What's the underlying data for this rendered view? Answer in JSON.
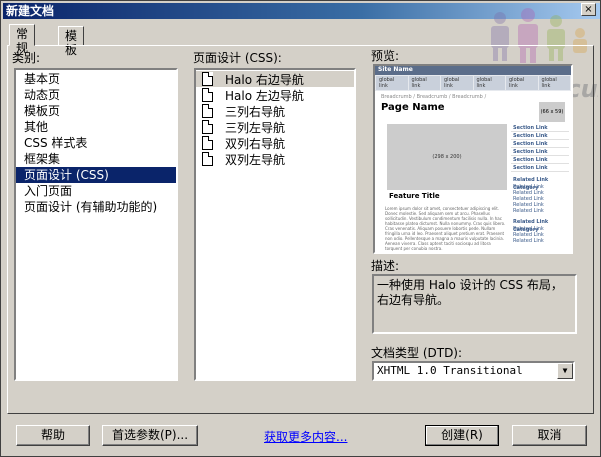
{
  "window": {
    "title": "新建文档",
    "close_glyph": "×"
  },
  "tabs": [
    {
      "label": "常规",
      "active": true
    },
    {
      "label": "模板",
      "active": false
    }
  ],
  "category": {
    "label": "类别:",
    "items": [
      "基本页",
      "动态页",
      "模板页",
      "其他",
      "CSS 样式表",
      "框架集",
      "页面设计 (CSS)",
      "入门页面",
      "页面设计 (有辅助功能的)"
    ],
    "selected_index": 6
  },
  "layouts": {
    "label": "页面设计 (CSS):",
    "items": [
      "Halo 右边导航",
      "Halo 左边导航",
      "三列右导航",
      "三列左导航",
      "双列右导航",
      "双列左导航"
    ],
    "selected_index": 0
  },
  "preview": {
    "label": "预览:",
    "page": {
      "site_name": "Site Name",
      "nav_items": [
        "global link",
        "global link",
        "global link",
        "global link",
        "global link",
        "global link"
      ],
      "breadcrumb": "Breadcrumb / Breadcrumb / Breadcrumb /",
      "page_name": "Page Name",
      "thumb": "(66 x 59)",
      "image": "(298 x 200)",
      "feature_title": "Feature Title",
      "body_text": "Lorem ipsum dolor sit amet, consectetuer adipiscing elit. Donec molestie. Sed aliquam sem ut arcu. Phasellus sollicitudin. Vestibulum condimentum facilisis nulla. In hac habitasse platea dictumst. Nulla nonummy. Cras quis libero. Cras venenatis. Aliquam posuere lobortis pede. Nullam fringilla urna id leo. Praesent aliquet pretium erat. Praesent non odio. Pellentesque a magna a mauris vulputate lacinia. Aenean viverra. Class aptent taciti sociosqu ad litora torquent per conubia nostra.",
      "section_links": [
        "Section Link",
        "Section Link",
        "Section Link",
        "Section Link",
        "Section Link",
        "Section Link"
      ],
      "related_category_1": "Related Link Category",
      "related_links_1": [
        "Related Link",
        "Related Link",
        "Related Link",
        "Related Link",
        "Related Link"
      ],
      "related_category_2": "Related Link Category",
      "related_links_2": [
        "Related Link",
        "Related Link",
        "Related Link"
      ]
    }
  },
  "watermark": {
    "text": "Discuz!"
  },
  "description": {
    "label": "描述:",
    "text": "一种使用 Halo 设计的 CSS 布局，右边有导航。"
  },
  "doctype": {
    "label": "文档类型 (DTD):",
    "value": "XHTML 1.0 Transitional",
    "arrow": "▼"
  },
  "buttons": {
    "help": "帮助",
    "prefs": "首选参数(P)...",
    "more": "获取更多内容...",
    "create": "创建(R)",
    "cancel": "取消"
  }
}
